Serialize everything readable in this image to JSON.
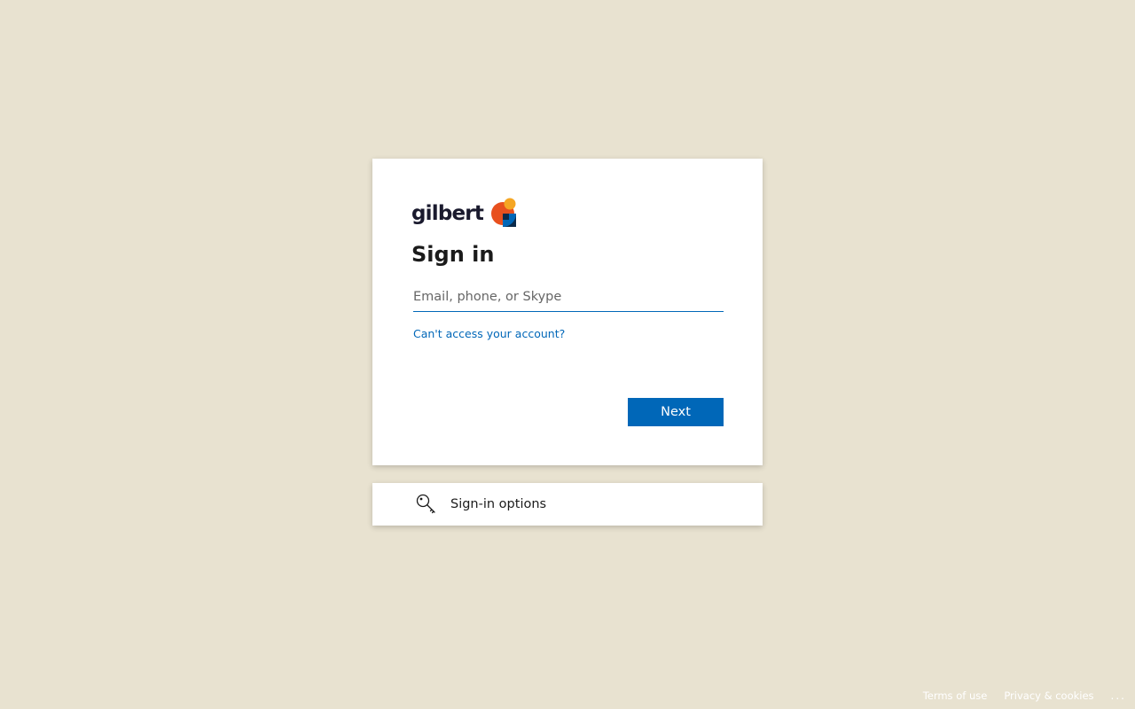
{
  "brand": {
    "name": "gilbert"
  },
  "signin": {
    "title": "Sign in",
    "email_placeholder": "Email, phone, or Skype",
    "email_value": "",
    "cant_access": "Can't access your account?",
    "next_label": "Next"
  },
  "options": {
    "label": "Sign-in options",
    "icon": "key-icon"
  },
  "footer": {
    "terms": "Terms of use",
    "privacy": "Privacy & cookies",
    "more": "..."
  },
  "colors": {
    "background": "#e8e2d0",
    "accent": "#0067b8",
    "logo_orange": "#e8501e",
    "logo_yellow": "#f5a623",
    "logo_navy": "#0b2a4a",
    "logo_blue": "#0067b8"
  }
}
